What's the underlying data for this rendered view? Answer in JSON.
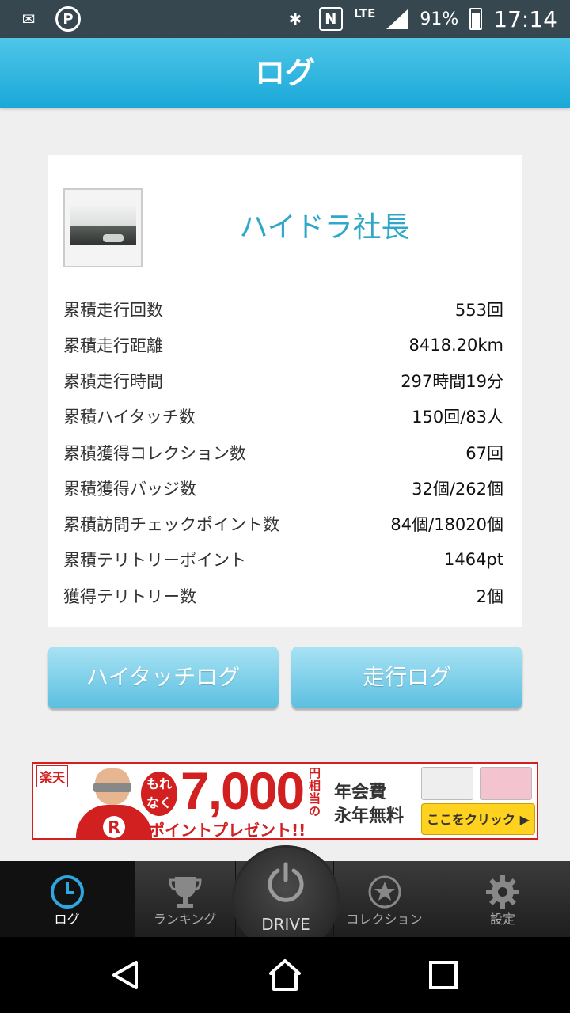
{
  "status_bar": {
    "left_icons": [
      "yahoo-mail-icon",
      "parking-icon"
    ],
    "lte": "LTE",
    "battery": "91%",
    "time": "17:14"
  },
  "header": {
    "title": "ログ"
  },
  "profile": {
    "name": "ハイドラ社長"
  },
  "stats": [
    {
      "label": "累積走行回数",
      "value": "553回"
    },
    {
      "label": "累積走行距離",
      "value": "8418.20km"
    },
    {
      "label": "累積走行時間",
      "value": "297時間19分"
    },
    {
      "label": "累積ハイタッチ数",
      "value": "150回/83人"
    },
    {
      "label": "累積獲得コレクション数",
      "value": "67回"
    },
    {
      "label": "累積獲得バッジ数",
      "value": "32個/262個"
    },
    {
      "label": "累積訪問チェックポイント数",
      "value": "84個/18020個"
    },
    {
      "label": "累積テリトリーポイント",
      "value": "1464pt"
    },
    {
      "label": "獲得テリトリー数",
      "value": "2個"
    }
  ],
  "buttons": {
    "hitouch_log": "ハイタッチログ",
    "drive_log": "走行ログ"
  },
  "ad": {
    "logo": "楽天",
    "badge": "もれなく",
    "amount": "7,000",
    "yen": "円相当の",
    "present": "ポイントプレゼント!!",
    "fee_line1": "年会費",
    "fee_line2": "永年無料",
    "cta": "ここをクリック ▶"
  },
  "tabs": [
    {
      "label": "ログ",
      "icon": "clock-icon",
      "active": true
    },
    {
      "label": "ランキング",
      "icon": "trophy-icon",
      "active": false
    },
    {
      "label": "コレクション",
      "icon": "star-icon",
      "active": false
    },
    {
      "label": "設定",
      "icon": "gear-icon",
      "active": false
    }
  ],
  "drive": {
    "label": "DRIVE",
    "icon": "power-icon"
  },
  "colors": {
    "header": "#1aa8d8",
    "accent_name": "#2ea7c9",
    "button": "#5cbfe0",
    "ad_red": "#d21f1f"
  }
}
